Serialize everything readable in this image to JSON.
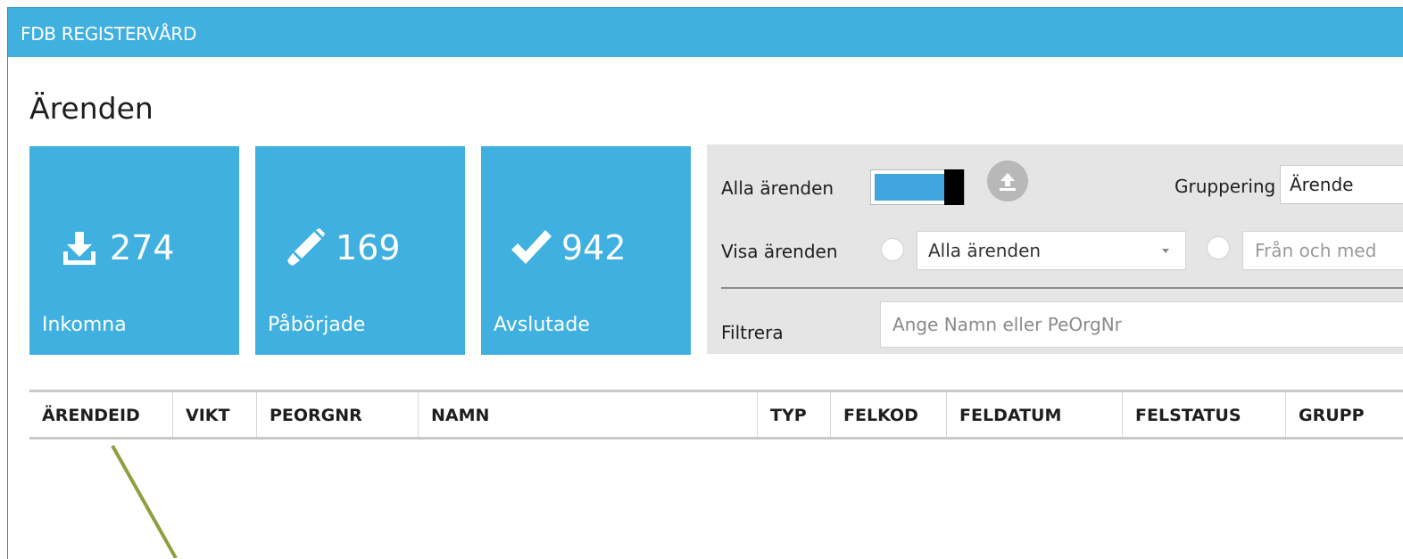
{
  "window": {
    "title": "FDB REGISTERVÅRD"
  },
  "page": {
    "title": "Ärenden"
  },
  "tiles": [
    {
      "icon": "download-icon",
      "count": "274",
      "label": "Inkomna"
    },
    {
      "icon": "pencil-icon",
      "count": "169",
      "label": "Påbörjade"
    },
    {
      "icon": "checkmark-icon",
      "count": "942",
      "label": "Avslutade"
    }
  ],
  "filters": {
    "all_cases_label": "Alla ärenden",
    "all_cases_toggle_on": true,
    "upload_icon": "upload-icon",
    "grouping_label": "Gruppering",
    "grouping_value": "Ärende",
    "show_cases_label": "Visa ärenden",
    "show_cases_value": "Alla ärenden",
    "from_placeholder": "Från och med",
    "filter_label": "Filtrera",
    "filter_placeholder": "Ange Namn eller PeOrgNr"
  },
  "table": {
    "columns": [
      "ÄRENDEID",
      "VIKT",
      "PEORGNR",
      "NAMN",
      "TYP",
      "FELKOD",
      "FELDATUM",
      "FELSTATUS",
      "GRUPP"
    ],
    "rows": []
  },
  "colors": {
    "accent": "#3fb0e0",
    "panel": "#e5e5e5",
    "annotation_line": "#8ca040"
  }
}
